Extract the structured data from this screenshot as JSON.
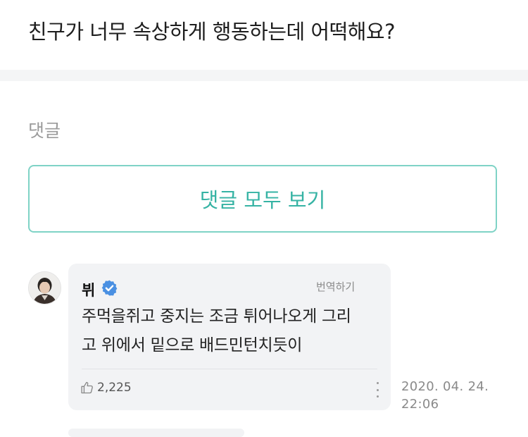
{
  "post": {
    "title": "친구가 너무 속상하게 행동하는데 어떡해요?"
  },
  "comments_section": {
    "label": "댓글",
    "view_all_label": "댓글 모두 보기"
  },
  "comment": {
    "author": "뷔",
    "verified_icon": "verified-badge-icon",
    "translate_label": "번역하기",
    "body_line1": "주먹을쥐고 중지는 조금 튀어나오게 그리",
    "body_line2": "고 위에서 밑으로 배드민턴치듯이",
    "like_count": "2,225",
    "date": "2020. 04. 24.",
    "time": "22:06",
    "colors": {
      "verified": "#4a90e2",
      "accent": "#36b3a4"
    }
  }
}
